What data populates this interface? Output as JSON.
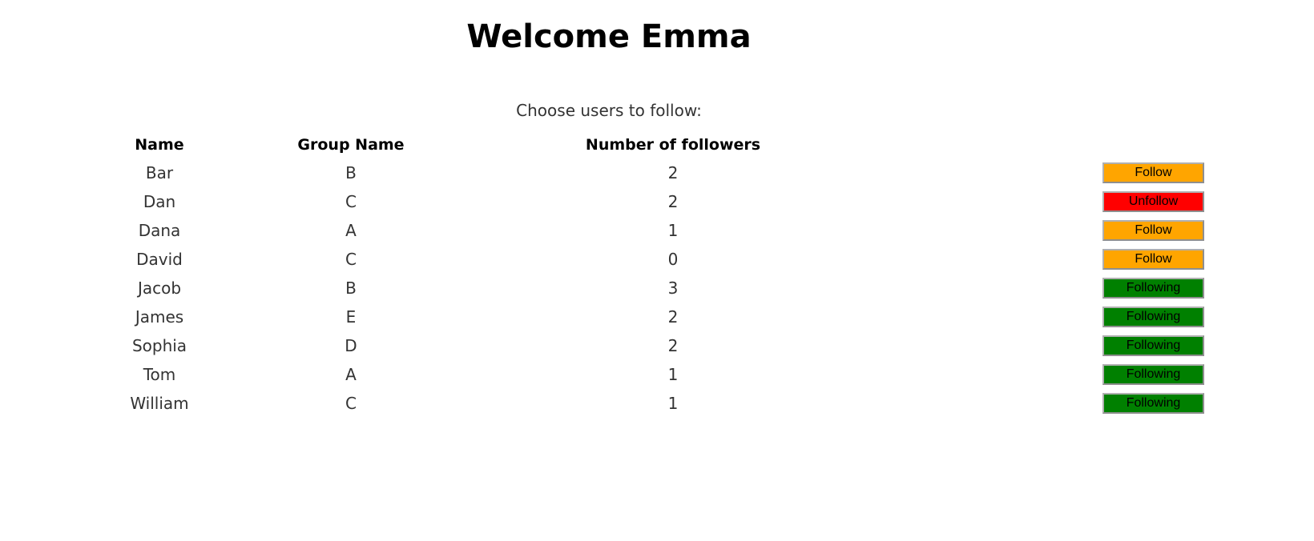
{
  "title": "Welcome Emma",
  "instruction": "Choose users to follow:",
  "table": {
    "headers": [
      "Name",
      "Group Name",
      "Number of followers",
      ""
    ],
    "rows": [
      {
        "name": "Bar",
        "group": "B",
        "followers": "2",
        "action": "Follow",
        "action_color": "#ffa500"
      },
      {
        "name": "Dan",
        "group": "C",
        "followers": "2",
        "action": "Unfollow",
        "action_color": "#ff0000"
      },
      {
        "name": "Dana",
        "group": "A",
        "followers": "1",
        "action": "Follow",
        "action_color": "#ffa500"
      },
      {
        "name": "David",
        "group": "C",
        "followers": "0",
        "action": "Follow",
        "action_color": "#ffa500"
      },
      {
        "name": "Jacob",
        "group": "B",
        "followers": "3",
        "action": "Following",
        "action_color": "#008000"
      },
      {
        "name": "James",
        "group": "E",
        "followers": "2",
        "action": "Following",
        "action_color": "#008000"
      },
      {
        "name": "Sophia",
        "group": "D",
        "followers": "2",
        "action": "Following",
        "action_color": "#008000"
      },
      {
        "name": "Tom",
        "group": "A",
        "followers": "1",
        "action": "Following",
        "action_color": "#008000"
      },
      {
        "name": "William",
        "group": "C",
        "followers": "1",
        "action": "Following",
        "action_color": "#008000"
      }
    ]
  }
}
